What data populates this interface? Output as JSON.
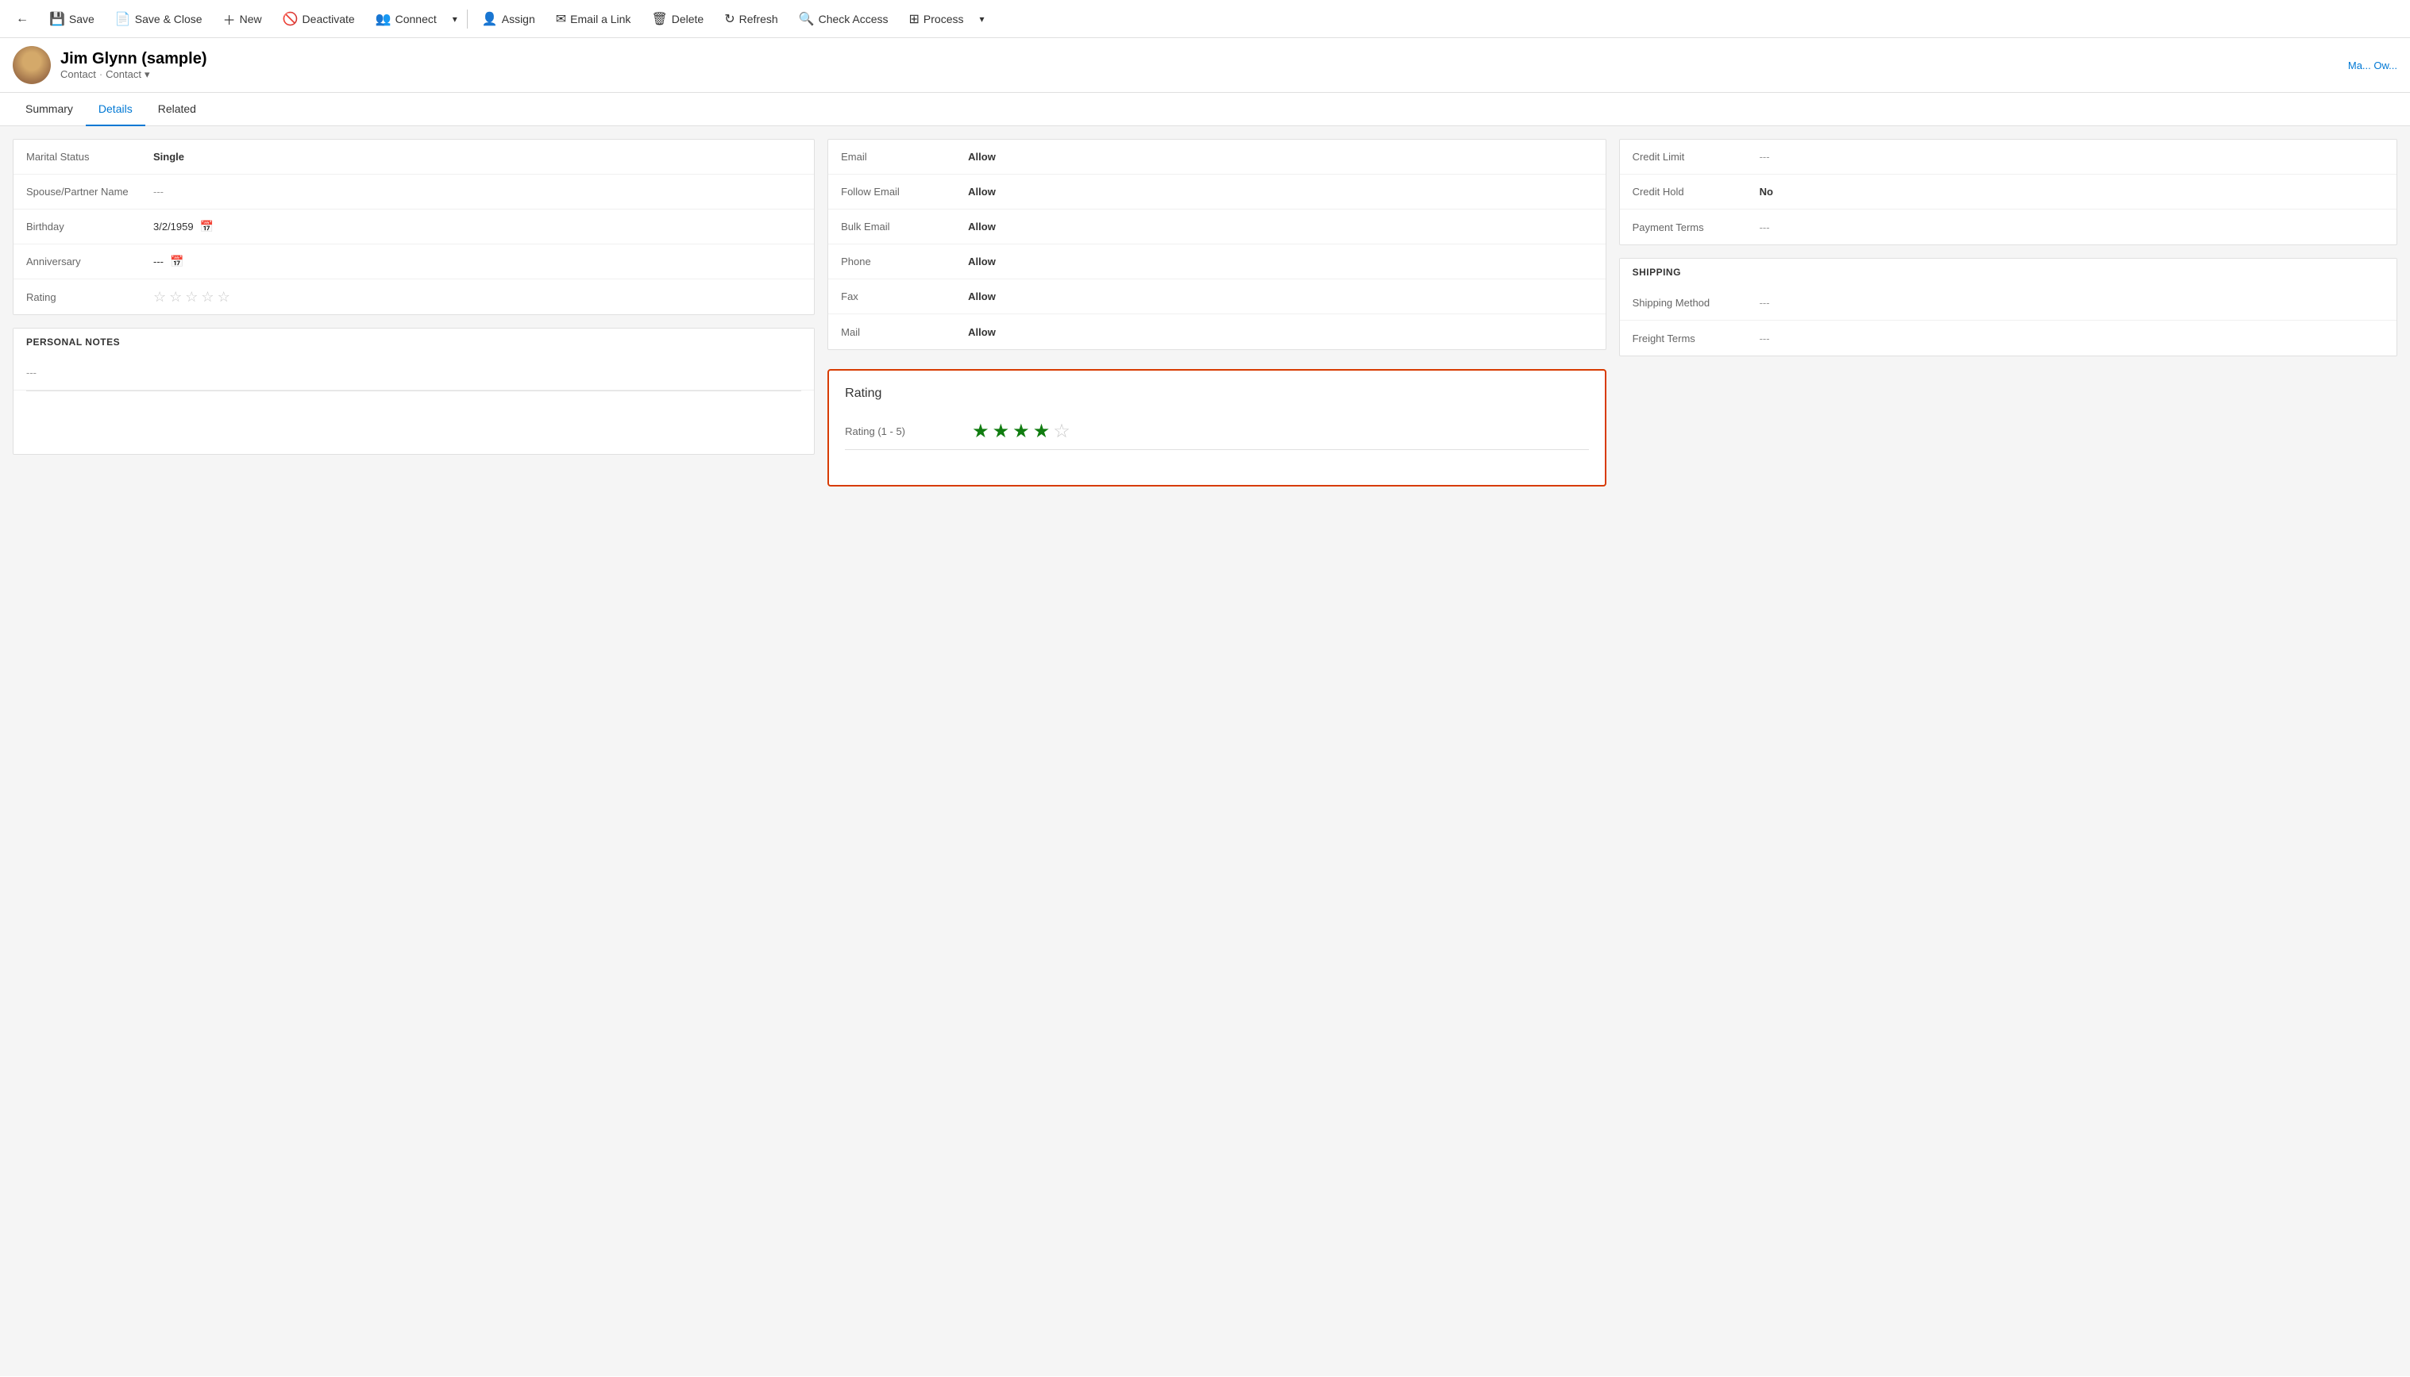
{
  "toolbar": {
    "back_label": "←",
    "save_label": "Save",
    "save_close_label": "Save & Close",
    "new_label": "New",
    "deactivate_label": "Deactivate",
    "connect_label": "Connect",
    "assign_label": "Assign",
    "email_link_label": "Email a Link",
    "delete_label": "Delete",
    "refresh_label": "Refresh",
    "check_access_label": "Check Access",
    "process_label": "Process"
  },
  "record": {
    "name": "Jim Glynn (sample)",
    "type_primary": "Contact",
    "type_secondary": "Contact",
    "header_right": "Ma... Ow..."
  },
  "tabs": {
    "summary": "Summary",
    "details": "Details",
    "related": "Related",
    "active": "details"
  },
  "personal_info": {
    "marital_status_label": "Marital Status",
    "marital_status_value": "Single",
    "spouse_label": "Spouse/Partner Name",
    "spouse_value": "---",
    "birthday_label": "Birthday",
    "birthday_value": "3/2/1959",
    "anniversary_label": "Anniversary",
    "anniversary_value": "---",
    "rating_label": "Rating",
    "rating_stars": [
      false,
      false,
      false,
      false,
      false
    ]
  },
  "personal_notes": {
    "title": "PERSONAL NOTES",
    "value": "---"
  },
  "contact_preferences": {
    "email_label": "Email",
    "email_value": "Allow",
    "follow_email_label": "Follow Email",
    "follow_email_value": "Allow",
    "bulk_email_label": "Bulk Email",
    "bulk_email_value": "Allow",
    "phone_label": "Phone",
    "phone_value": "Allow",
    "fax_label": "Fax",
    "fax_value": "Allow",
    "mail_label": "Mail",
    "mail_value": "Allow"
  },
  "billing": {
    "credit_limit_label": "Credit Limit",
    "credit_limit_value": "---",
    "credit_hold_label": "Credit Hold",
    "credit_hold_value": "No",
    "payment_terms_label": "Payment Terms",
    "payment_terms_value": "---"
  },
  "shipping": {
    "title": "SHIPPING",
    "shipping_method_label": "Shipping Method",
    "shipping_method_value": "---",
    "freight_terms_label": "Freight Terms",
    "freight_terms_value": "---"
  },
  "rating_popup": {
    "title": "Rating",
    "rating_label": "Rating (1 - 5)",
    "rating_filled": 4,
    "rating_total": 5
  }
}
